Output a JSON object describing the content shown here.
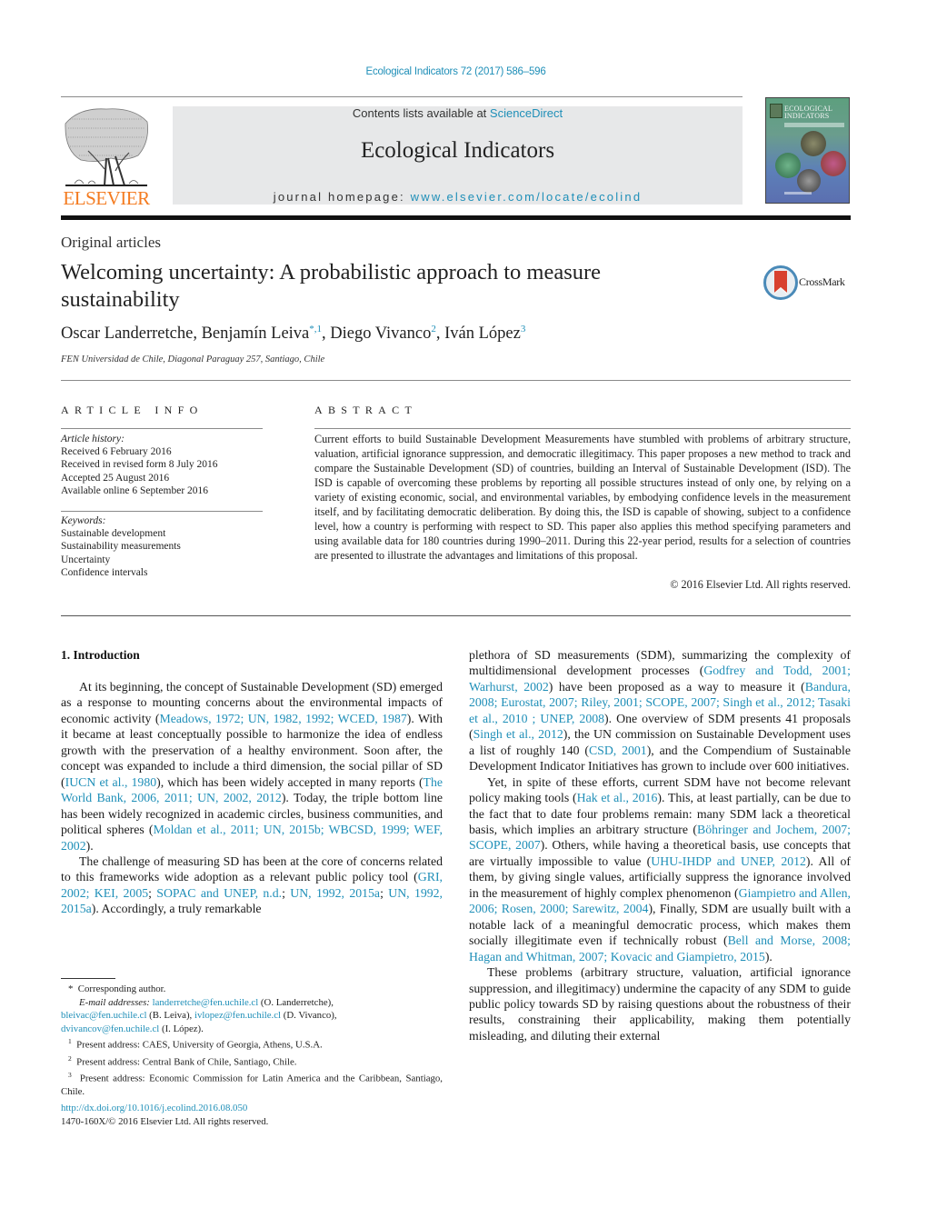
{
  "header": {
    "journal_ref": "Ecological Indicators 72 (2017) 586–596",
    "contents_prefix": "Contents lists available at ",
    "contents_link": "ScienceDirect",
    "journal_name": "Ecological Indicators",
    "homepage_prefix": "journal homepage: ",
    "homepage_link": "www.elsevier.com/locate/ecolind",
    "publisher_logo": "ELSEVIER",
    "cover_title_line1": "ECOLOGICAL",
    "cover_title_line2": "INDICATORS"
  },
  "article": {
    "section": "Original articles",
    "title": "Welcoming uncertainty: A probabilistic approach to measure sustainability",
    "crossmark_label": "CrossMark",
    "authors": [
      {
        "name": "Oscar Landerretche",
        "sup": ""
      },
      {
        "name": "Benjamín Leiva",
        "sup": "*,1"
      },
      {
        "name": "Diego Vivanco",
        "sup": "2"
      },
      {
        "name": "Iván López",
        "sup": "3"
      }
    ],
    "affiliation": "FEN Universidad de Chile, Diagonal Paraguay 257, Santiago, Chile"
  },
  "article_info": {
    "heading": "ARTICLE INFO",
    "history_label": "Article history:",
    "history": [
      "Received 6 February 2016",
      "Received in revised form 8 July 2016",
      "Accepted 25 August 2016",
      "Available online 6 September 2016"
    ],
    "keywords_label": "Keywords:",
    "keywords": [
      "Sustainable development",
      "Sustainability measurements",
      "Uncertainty",
      "Confidence intervals"
    ]
  },
  "abstract": {
    "heading": "ABSTRACT",
    "text": "Current efforts to build Sustainable Development Measurements have stumbled with problems of arbitrary structure, valuation, artificial ignorance suppression, and democratic illegitimacy. This paper proposes a new method to track and compare the Sustainable Development (SD) of countries, building an Interval of Sustainable Development (ISD). The ISD is capable of overcoming these problems by reporting all possible structures instead of only one, by relying on a variety of existing economic, social, and environmental variables, by embodying confidence levels in the measurement itself, and by facilitating democratic deliberation. By doing this, the ISD is capable of showing, subject to a confidence level, how a country is performing with respect to SD. This paper also applies this method specifying parameters and using available data for 180 countries during 1990–2011. During this 22-year period, results for a selection of countries are presented to illustrate the advantages and limitations of this proposal.",
    "copyright": "© 2016 Elsevier Ltd. All rights reserved."
  },
  "body": {
    "section_heading": "1.  Introduction",
    "left_paragraphs": [
      [
        {
          "t": "At its beginning, the concept of Sustainable Development (SD) emerged as a response to mounting concerns about the environmental impacts of economic activity ("
        },
        {
          "l": "Meadows, 1972; UN, 1982, 1992; WCED, 1987"
        },
        {
          "t": "). With it became at least conceptually possible to harmonize the idea of endless growth with the preservation of a healthy environment. Soon after, the concept was expanded to include a third dimension, the social pillar of SD ("
        },
        {
          "l": "IUCN et al., 1980"
        },
        {
          "t": "), which has been widely accepted in many reports ("
        },
        {
          "l": "The World Bank, 2006, 2011; UN, 2002, 2012"
        },
        {
          "t": "). Today, the triple bottom line has been widely recognized in academic circles, business communities, and political spheres ("
        },
        {
          "l": "Moldan et al., 2011; UN, 2015b; WBCSD, 1999; WEF, 2002"
        },
        {
          "t": ")."
        }
      ],
      [
        {
          "t": "The challenge of measuring SD has been at the core of concerns related to this frameworks wide adoption as a relevant public policy tool ("
        },
        {
          "l": "GRI, 2002; KEI, 2005"
        },
        {
          "t": "; "
        },
        {
          "l": "SOPAC and UNEP, n.d."
        },
        {
          "t": "; "
        },
        {
          "l": "UN, 1992, 2015a"
        },
        {
          "t": "; "
        },
        {
          "l": "UN, 1992, 2015a"
        },
        {
          "t": "). Accordingly, a truly remarkable"
        }
      ]
    ],
    "right_paragraphs": [
      [
        {
          "t": "plethora of SD measurements (SDM), summarizing the complexity of multidimensional development processes ("
        },
        {
          "l": "Godfrey and Todd, 2001; Warhurst, 2002"
        },
        {
          "t": ") have been proposed as a way to measure it ("
        },
        {
          "l": "Bandura, 2008; Eurostat, 2007; Riley, 2001; SCOPE, 2007; Singh et al., 2012; Tasaki et al., 2010 ; UNEP, 2008"
        },
        {
          "t": "). One overview of SDM presents 41 proposals ("
        },
        {
          "l": "Singh et al., 2012"
        },
        {
          "t": "), the UN commission on Sustainable Development uses a list of roughly 140 ("
        },
        {
          "l": "CSD, 2001"
        },
        {
          "t": "), and the Compendium of Sustainable Development Indicator Initiatives has grown to include over 600 initiatives."
        }
      ],
      [
        {
          "t": "Yet, in spite of these efforts, current SDM have not become relevant policy making tools ("
        },
        {
          "l": "Hak et al., 2016"
        },
        {
          "t": "). This, at least partially, can be due to the fact that to date four problems remain: many SDM lack a theoretical basis, which implies an arbitrary structure ("
        },
        {
          "l": "Böhringer and Jochem, 2007; SCOPE, 2007"
        },
        {
          "t": "). Others, while having a theoretical basis, use concepts that are virtually impossible to value ("
        },
        {
          "l": "UHU-IHDP and UNEP, 2012"
        },
        {
          "t": "). All of them, by giving single values, artificially suppress the ignorance involved in the measurement of highly complex phenomenon ("
        },
        {
          "l": "Giampietro and Allen, 2006; Rosen, 2000; Sarewitz, 2004"
        },
        {
          "t": "), Finally, SDM are usually built with a notable lack of a meaningful democratic process, which makes them socially illegitimate even if technically robust ("
        },
        {
          "l": "Bell and Morse, 2008; Hagan and Whitman, 2007; Kovacic and Giampietro, 2015"
        },
        {
          "t": ")."
        }
      ],
      [
        {
          "t": "These problems (arbitrary structure, valuation, artificial ignorance suppression, and illegitimacy) undermine the capacity of any SDM to guide public policy towards SD by raising questions about the robustness of their results, constraining their applicability, making them potentially misleading, and diluting their external"
        }
      ]
    ]
  },
  "footnotes": {
    "corresponding": "Corresponding author.",
    "email_label": "E-mail addresses:",
    "emails": [
      {
        "email": "landerretche@fen.uchile.cl",
        "who": " (O. Landerretche),"
      },
      {
        "email": "bleivac@fen.uchile.cl",
        "who": " (B. Leiva), "
      },
      {
        "email": "ivlopez@fen.uchile.cl",
        "who": " (D. Vivanco),"
      },
      {
        "email": "dvivancov@fen.uchile.cl",
        "who": " (I. López)."
      }
    ],
    "addresses": [
      {
        "num": "1",
        "text": "Present address: CAES, University of Georgia, Athens, U.S.A."
      },
      {
        "num": "2",
        "text": "Present address: Central Bank of Chile, Santiago, Chile."
      },
      {
        "num": "3",
        "text": "Present address: Economic Commission for Latin America and the Caribbean, Santiago, Chile."
      }
    ],
    "doi": "http://dx.doi.org/10.1016/j.ecolind.2016.08.050",
    "issn": "1470-160X/© 2016 Elsevier Ltd. All rights reserved."
  },
  "colors": {
    "link": "#1f8fb8",
    "elsevier_orange": "#f47b20",
    "banner_gray": "#e7e8e9",
    "crossmark_red": "#d8412f",
    "crossmark_blue": "#4a8ab8"
  }
}
